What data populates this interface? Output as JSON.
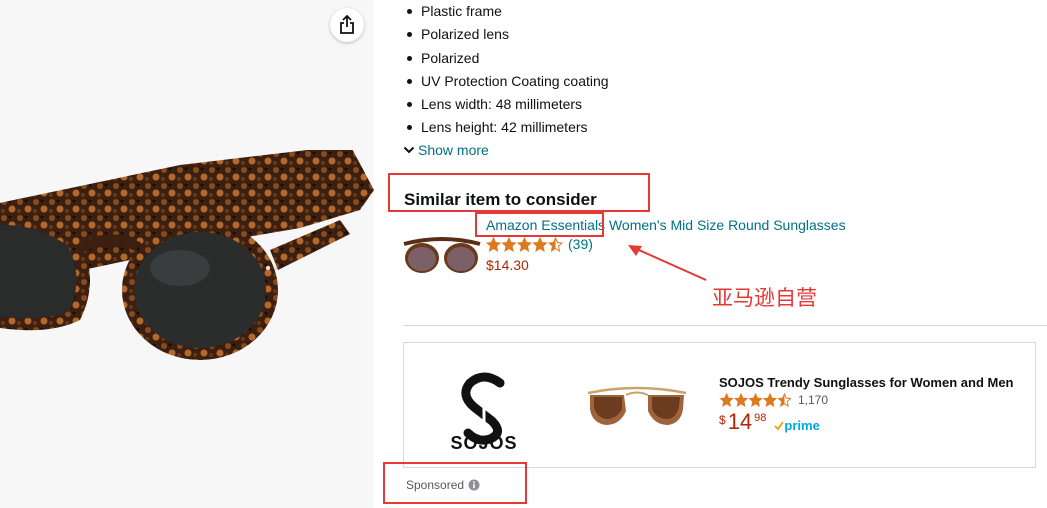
{
  "details": {
    "bullets": [
      "Plastic frame",
      "Polarized lens",
      "Polarized",
      "UV Protection Coating coating",
      "Lens width: 48 millimeters",
      "Lens height: 42 millimeters"
    ],
    "show_more": "Show more"
  },
  "similar": {
    "heading": "Similar item to consider",
    "brand": "Amazon Essentials",
    "title_rest": " Women's Mid Size Round Sunglasses",
    "rating_stars": 4.5,
    "rating_count": "(39)",
    "price": "$14.30"
  },
  "sponsored_ad": {
    "brand": "SOJOS",
    "title": "SOJOS Trendy Sunglasses for Women and Men",
    "rating_stars": 4.5,
    "rating_count": "1,170",
    "price_symbol": "$",
    "price_whole": "14",
    "price_fraction": "98",
    "prime_label": "prime",
    "sponsored_label": "Sponsored"
  },
  "annotation": {
    "text": "亚马逊自营"
  },
  "colors": {
    "link": "#007185",
    "price": "#b12704",
    "star": "#de7921",
    "annotation": "#e53935",
    "prime": "#00a8e1"
  },
  "icons": [
    "share-icon",
    "chevron-down-icon",
    "star-icon",
    "info-icon",
    "prime-check-icon"
  ]
}
